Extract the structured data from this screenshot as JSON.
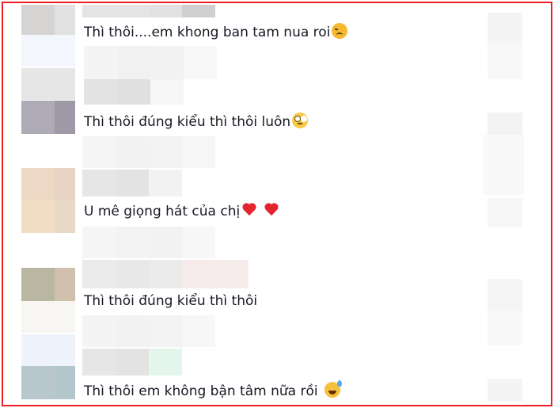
{
  "comments": [
    {
      "text": "Thì thôi....em khong ban tam nua roi",
      "emoji": "disappointed-face-icon"
    },
    {
      "text": "Thì thôi đúng kiểu thì thôi luôn",
      "emoji": "face-with-rolling-eyes-icon"
    },
    {
      "text": "U mê giọng hát của chị",
      "emoji": "red-heart-icon"
    },
    {
      "text": "Thì thôi đúng kiểu thì thôi",
      "emoji": ""
    },
    {
      "text": "Thì thôi em không bận tâm nữa rồi",
      "emoji": "grinning-face-with-sweat-icon"
    }
  ],
  "colors": {
    "border": "#ee1c24",
    "text": "#161823",
    "heart": "#e4252f"
  }
}
